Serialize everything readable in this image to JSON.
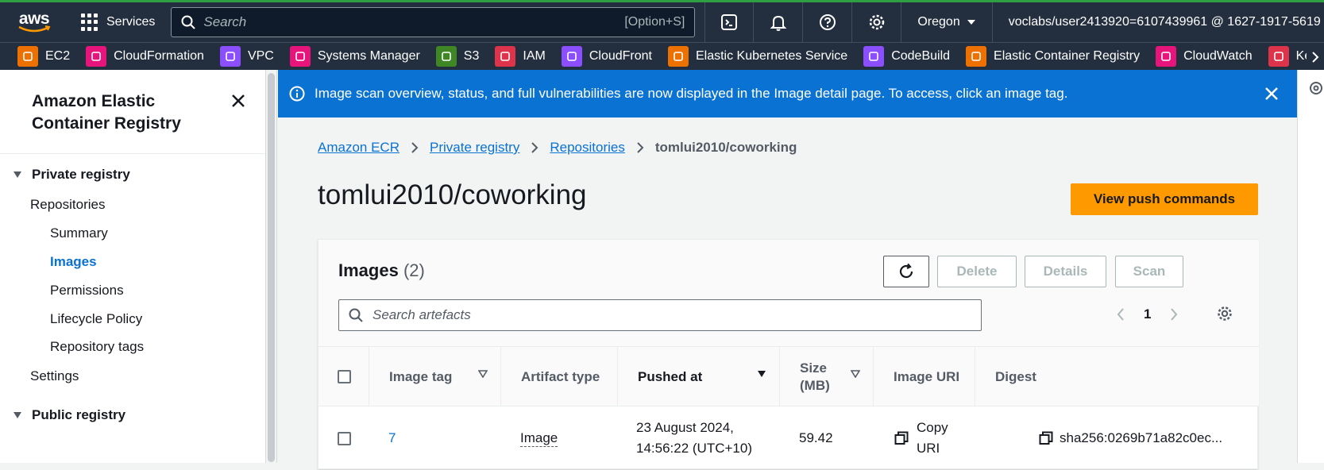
{
  "topnav": {
    "logo_text": "aws",
    "services_label": "Services",
    "search_placeholder": "Search",
    "search_shortcut": "[Option+S]",
    "region": "Oregon",
    "account": "voclabs/user2413920=6107439961 @ 1627-1917-5619"
  },
  "favorites": [
    {
      "label": "EC2",
      "color": "#ed7100"
    },
    {
      "label": "CloudFormation",
      "color": "#e7157b"
    },
    {
      "label": "VPC",
      "color": "#8c4fff"
    },
    {
      "label": "Systems Manager",
      "color": "#e7157b"
    },
    {
      "label": "S3",
      "color": "#3f8624"
    },
    {
      "label": "IAM",
      "color": "#dd344c"
    },
    {
      "label": "CloudFront",
      "color": "#8c4fff"
    },
    {
      "label": "Elastic Kubernetes Service",
      "color": "#ed7100"
    },
    {
      "label": "CodeBuild",
      "color": "#8c4fff"
    },
    {
      "label": "Elastic Container Registry",
      "color": "#ed7100"
    },
    {
      "label": "CloudWatch",
      "color": "#e7157b"
    },
    {
      "label": "Key Mana",
      "color": "#dd344c"
    }
  ],
  "sidebar": {
    "title": "Amazon Elastic Container Registry",
    "private_registry": "Private registry",
    "repositories": "Repositories",
    "summary": "Summary",
    "images": "Images",
    "permissions": "Permissions",
    "lifecycle_policy": "Lifecycle Policy",
    "repository_tags": "Repository tags",
    "settings": "Settings",
    "public_registry": "Public registry"
  },
  "flash": {
    "message": "Image scan overview, status, and full vulnerabilities are now displayed in the Image detail page. To access, click an image tag."
  },
  "breadcrumb": {
    "items": [
      "Amazon ECR",
      "Private registry",
      "Repositories"
    ],
    "current": "tomlui2010/coworking"
  },
  "page": {
    "title": "tomlui2010/coworking",
    "push_button": "View push commands"
  },
  "images_panel": {
    "title": "Images",
    "count": "(2)",
    "delete_label": "Delete",
    "details_label": "Details",
    "scan_label": "Scan",
    "search_placeholder": "Search artefacts",
    "page_number": "1",
    "columns": {
      "image_tag": "Image tag",
      "artifact_type": "Artifact type",
      "pushed_at": "Pushed at",
      "size_line1": "Size",
      "size_line2": "(MB)",
      "image_uri": "Image URI",
      "digest": "Digest"
    },
    "rows": [
      {
        "image_tag": "7",
        "artifact_type": "Image",
        "pushed_at_line1": "23 August 2024,",
        "pushed_at_line2": "14:56:22 (UTC+10)",
        "size": "59.42",
        "uri_line1": "Copy",
        "uri_line2": "URI",
        "digest": "sha256:0269b71a82c0ec..."
      }
    ]
  }
}
